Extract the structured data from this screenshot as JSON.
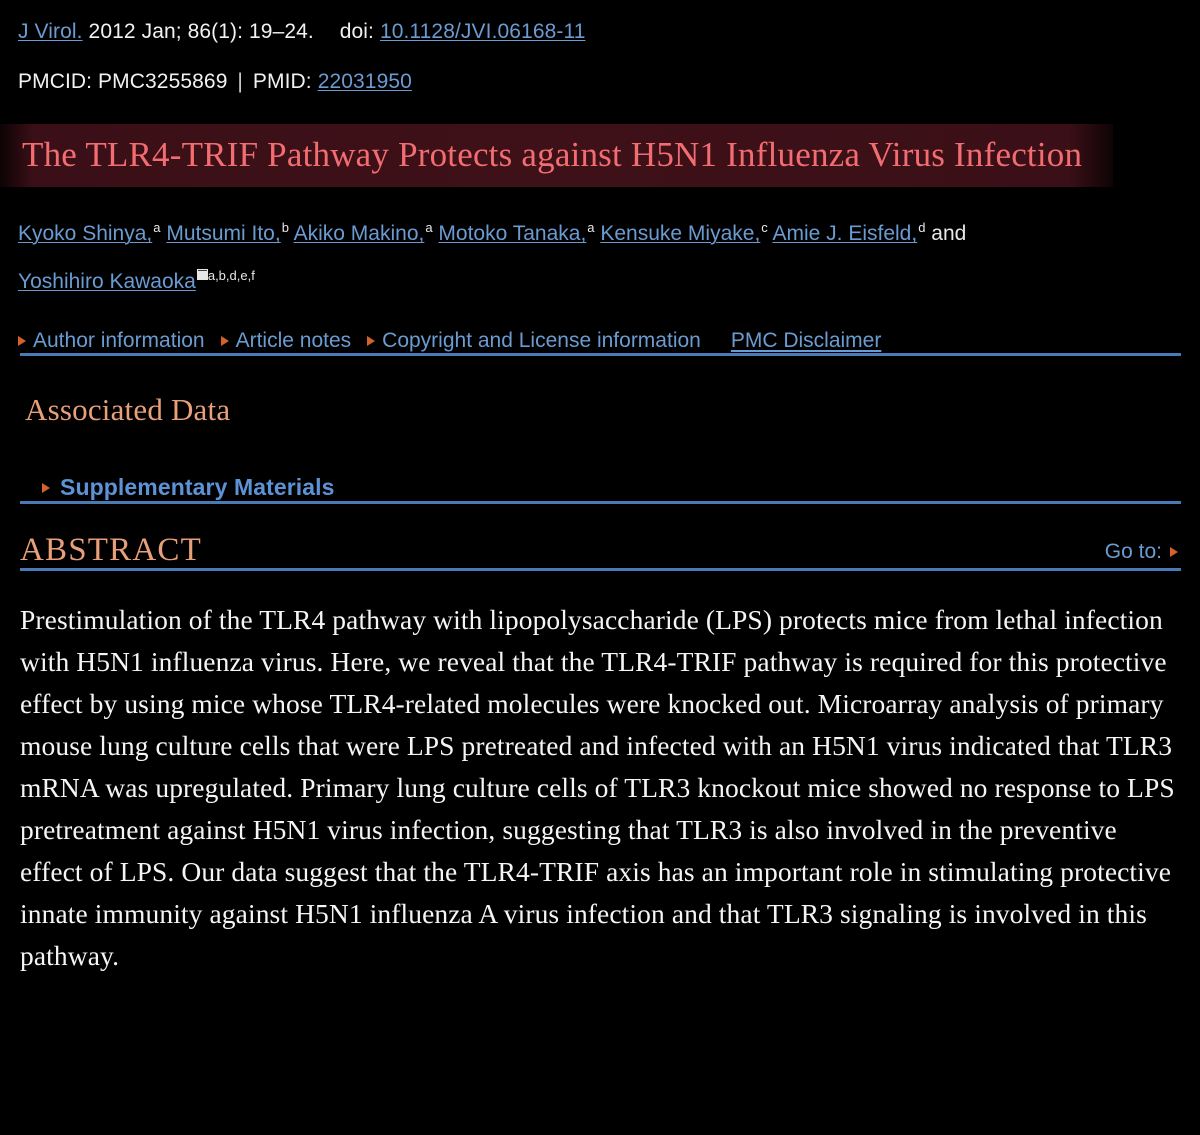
{
  "citation": {
    "journal": "J Virol.",
    "details": "2012 Jan; 86(1): 19–24.",
    "doi_label": "doi:",
    "doi_value": "10.1128/JVI.06168-11",
    "pmcid_label": "PMCID:",
    "pmcid_value": "PMC3255869",
    "separator": "|",
    "pmid_label": "PMID:",
    "pmid_value": "22031950"
  },
  "article": {
    "title": "The TLR4-TRIF Pathway Protects against H5N1 Influenza Virus Infection",
    "title_highlight_color": "#3e1018",
    "title_text_color": "#f26d72"
  },
  "authors": {
    "list": [
      {
        "name": "Kyoko Shinya,",
        "affiliation": "a"
      },
      {
        "name": "Mutsumi Ito,",
        "affiliation": "b"
      },
      {
        "name": "Akiko Makino,",
        "affiliation": "a"
      },
      {
        "name": "Motoko Tanaka,",
        "affiliation": "a"
      },
      {
        "name": "Kensuke Miyake,",
        "affiliation": "c"
      },
      {
        "name": "Amie J. Eisfeld,",
        "affiliation": "d"
      }
    ],
    "conjunction": "and",
    "corresponding": {
      "name": "Yoshihiro Kawaoka",
      "icon": "envelope-icon",
      "affiliation": "a,b,d,e,f"
    }
  },
  "meta_links": {
    "items": [
      {
        "label": "Author information",
        "marker": "triangle-right-icon"
      },
      {
        "label": "Article notes",
        "marker": "triangle-right-icon"
      },
      {
        "label": "Copyright and License information",
        "marker": "triangle-right-icon"
      }
    ],
    "disclaimer": "PMC Disclaimer"
  },
  "associated_data": {
    "heading": "Associated Data",
    "items": [
      {
        "label": "Supplementary Materials",
        "marker": "triangle-right-icon"
      }
    ]
  },
  "abstract": {
    "heading": "ABSTRACT",
    "goto_label": "Go to:",
    "goto_marker": "triangle-right-icon",
    "body": "Prestimulation of the TLR4 pathway with lipopolysaccharide (LPS) protects mice from lethal infection with H5N1 influenza virus. Here, we reveal that the TLR4-TRIF pathway is required for this protective effect by using mice whose TLR4-related molecules were knocked out. Microarray analysis of primary mouse lung culture cells that were LPS pretreated and infected with an H5N1 virus indicated that TLR3 mRNA was upregulated. Primary lung culture cells of TLR3 knockout mice showed no response to LPS pretreatment against H5N1 virus infection, suggesting that TLR3 is also involved in the preventive effect of LPS. Our data suggest that the TLR4-TRIF axis has an important role in stimulating protective innate immunity against H5N1 influenza A virus infection and that TLR3 signaling is involved in this pathway."
  },
  "theme": {
    "background": "#000000",
    "link_color": "#6a9bd1",
    "rule_color": "#4a7ab5",
    "accent_orange": "#d4622a",
    "heading_salmon": "#e8a07a",
    "text_color": "#f5f5f5"
  }
}
